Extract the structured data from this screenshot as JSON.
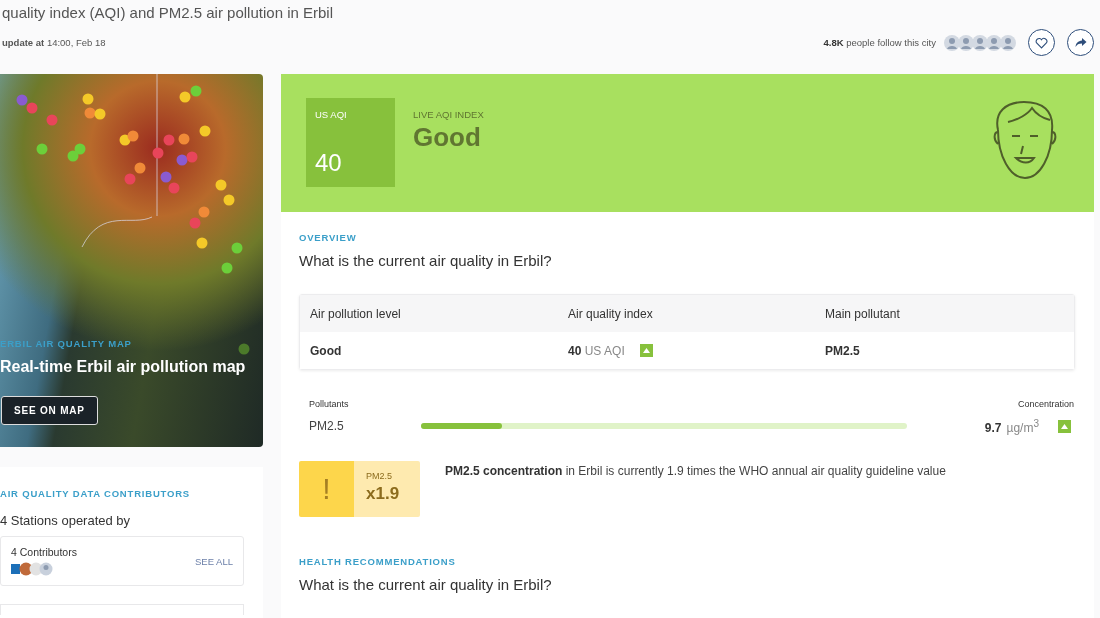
{
  "header": {
    "title": "quality index (AQI) and PM2.5 air pollution in Erbil",
    "update_label": "update at",
    "update_time": "14:00, Feb 18",
    "followers_count": "4.8K",
    "followers_text": "people follow this city"
  },
  "map_card": {
    "eyebrow": "ERBIL AIR QUALITY MAP",
    "title": "Real-time Erbil air pollution map",
    "button": "SEE ON MAP"
  },
  "contributors": {
    "eyebrow": "AIR QUALITY DATA CONTRIBUTORS",
    "title": "4 Stations operated by",
    "count": "4 Contributors",
    "link": "SEE ALL"
  },
  "aqi_banner": {
    "badge_label": "US AQI",
    "value": "40",
    "index_label": "LIVE AQI INDEX",
    "status": "Good"
  },
  "overview": {
    "eyebrow": "OVERVIEW",
    "question": "What is the current air quality in Erbil?",
    "table": {
      "columns": [
        "Air pollution level",
        "Air quality index",
        "Main pollutant"
      ],
      "rows": [
        {
          "level": "Good",
          "aqi": "40",
          "aqi_unit": "US AQI",
          "pollutant": "PM2.5"
        }
      ]
    }
  },
  "pollutants": {
    "column_label": "Pollutants",
    "concentration_label": "Concentration",
    "items": [
      {
        "name": "PM2.5",
        "level": 0.167,
        "value": "9.7",
        "unit": "µg/m$^{3}$"
      }
    ]
  },
  "who": {
    "icon": "!",
    "pollutant": "PM2.5",
    "multiplier": "x1.9",
    "text": "**PM2.5 concentration** in Erbil is currently 1.9 times the WHO annual air quality guideline value"
  },
  "health": {
    "eyebrow": "HEALTH RECOMMENDATIONS",
    "question": "What is the current air quality in Erbil?"
  }
}
